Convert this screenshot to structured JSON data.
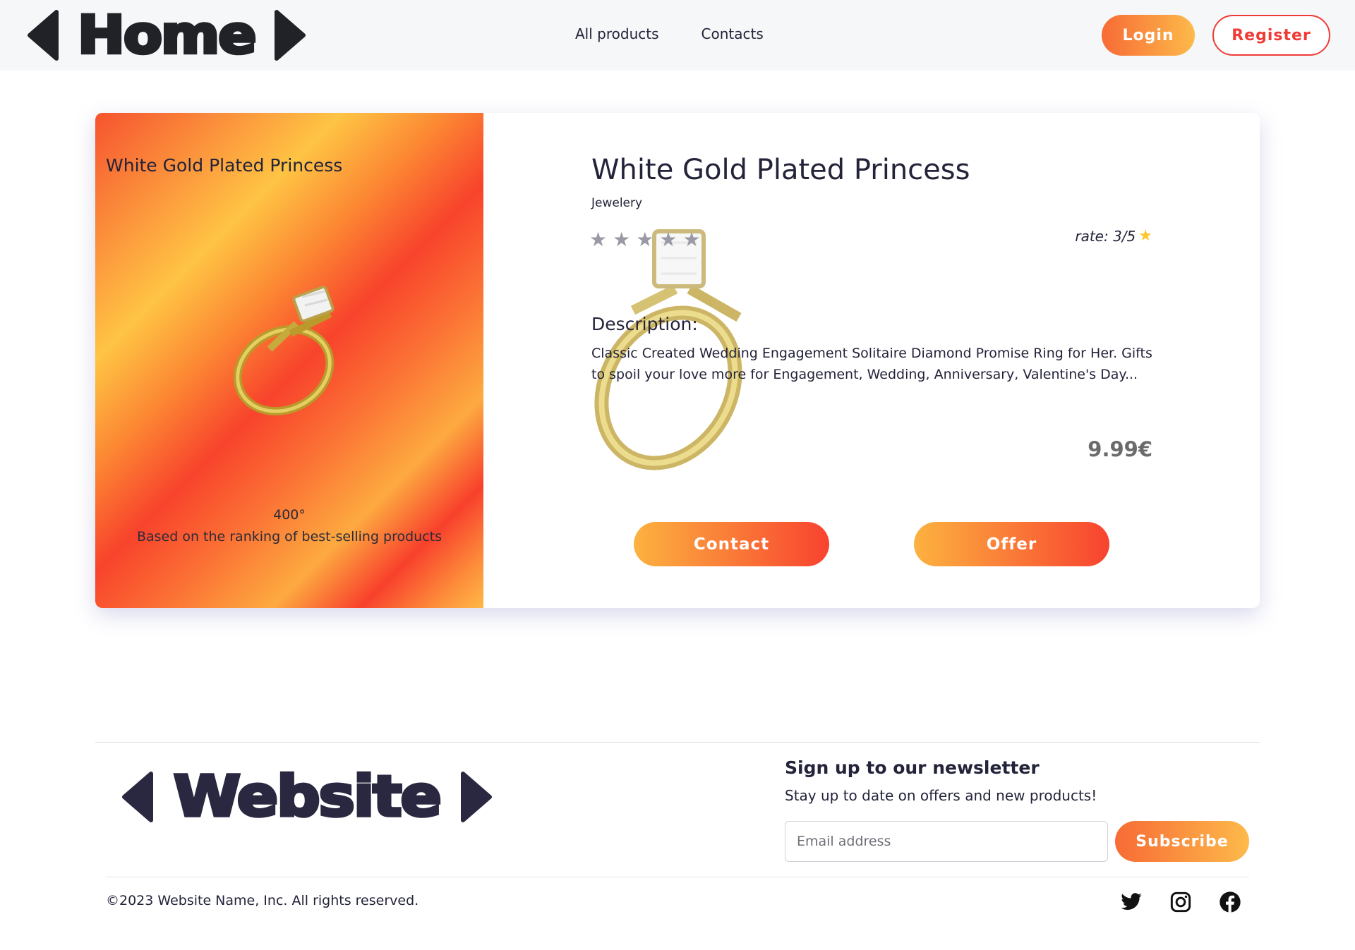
{
  "header": {
    "brand": "Home",
    "nav": [
      "All products",
      "Contacts"
    ],
    "login_label": "Login",
    "register_label": "Register"
  },
  "product": {
    "card_title": "White Gold Plated Princess",
    "title": "White Gold Plated Princess",
    "category": "Jewelery",
    "rating_stars": 3,
    "rating_max": 5,
    "rate_label": "rate: 3/5",
    "rank_value": "400°",
    "rank_note": "Based on the ranking of best-selling products",
    "description_heading": "Description:",
    "description": "Classic Created Wedding Engagement Solitaire Diamond Promise Ring for Her. Gifts to spoil your love more for Engagement, Wedding, Anniversary, Valentine's Day...",
    "price": "9.99€",
    "contact_label": "Contact",
    "offer_label": "Offer",
    "image_icon": "ring-image"
  },
  "footer": {
    "brand": "Website",
    "newsletter_title": "Sign up to our newsletter",
    "newsletter_subtitle": "Stay up to date on offers and new products!",
    "email_placeholder": "Email address",
    "subscribe_label": "Subscribe",
    "copyright": "©2023 Website Name, Inc. All rights reserved.",
    "social_icons": [
      "twitter-icon",
      "instagram-icon",
      "facebook-icon"
    ]
  },
  "colors": {
    "accent_orange": "#f76b35",
    "accent_yellow": "#fdba4a",
    "accent_red": "#ef3b36",
    "star_gold": "#fcc62c",
    "text_dark": "#23233a"
  }
}
